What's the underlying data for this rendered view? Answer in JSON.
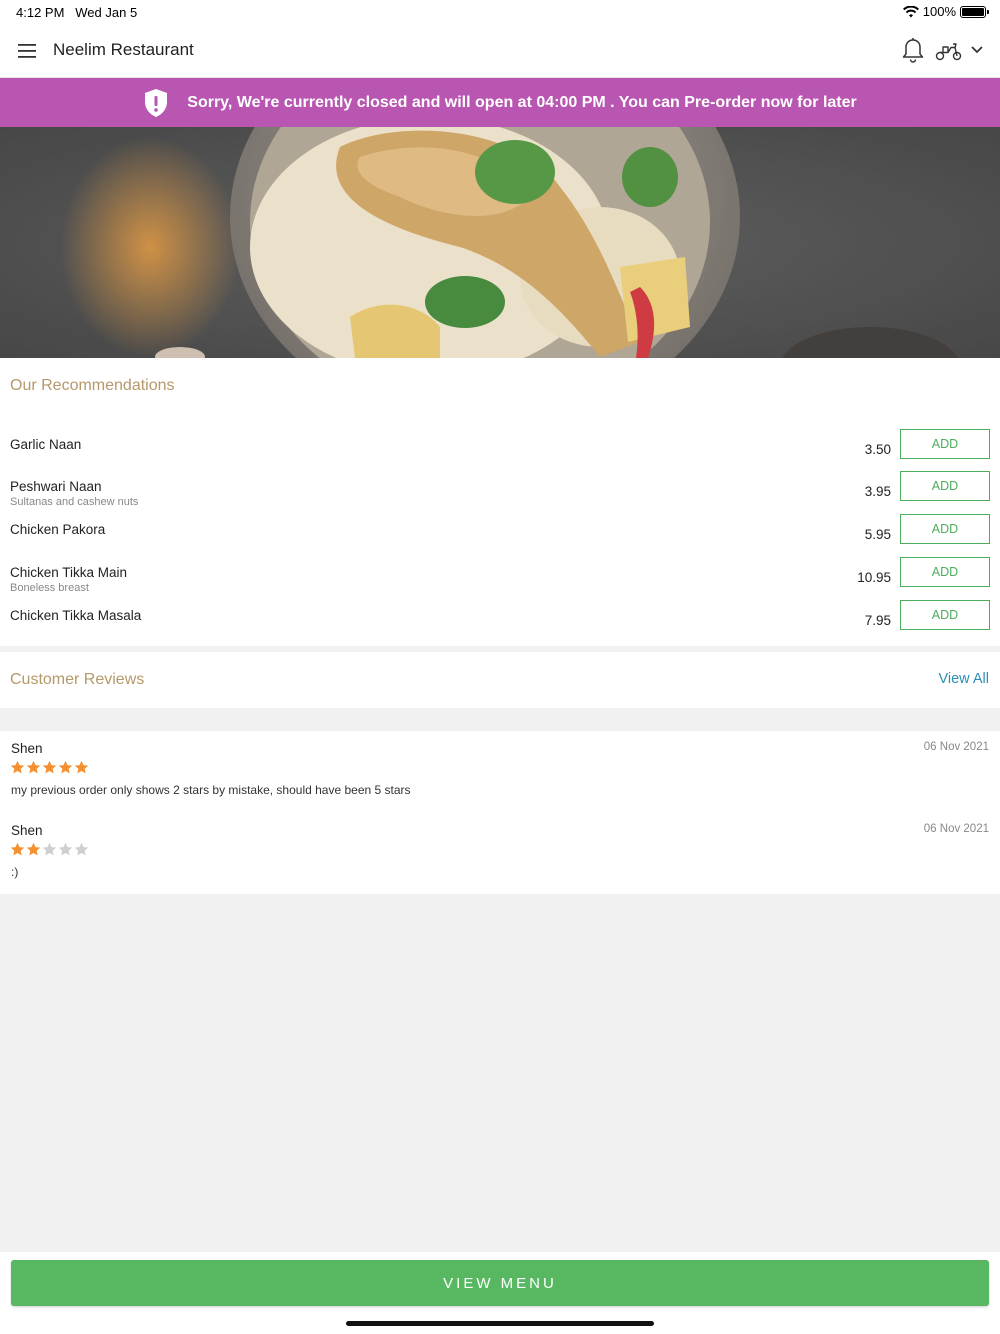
{
  "status_bar": {
    "time": "4:12 PM",
    "date": "Wed Jan 5",
    "battery": "100%",
    "battery_level": 1.0
  },
  "header": {
    "title": "Neelim Restaurant",
    "icons": [
      "menu-icon",
      "bell-icon",
      "scooter-icon",
      "chevron-down-icon"
    ]
  },
  "banner": {
    "message": "Sorry, We're currently closed and will open at 04:00 PM . You can Pre-order now for later",
    "icon": "shield-alert-icon",
    "color": "#b856b2"
  },
  "recommendations": {
    "title": "Our Recommendations",
    "add_label": "ADD",
    "items": [
      {
        "name": "Garlic Naan",
        "description": "",
        "price": "3.50"
      },
      {
        "name": "Peshwari Naan",
        "description": "Sultanas and cashew nuts",
        "price": "3.95"
      },
      {
        "name": "Chicken Pakora",
        "description": "",
        "price": "5.95"
      },
      {
        "name": "Chicken Tikka Main",
        "description": "Boneless breast",
        "price": "10.95"
      },
      {
        "name": "Chicken Tikka Masala",
        "description": "",
        "price": "7.95"
      }
    ]
  },
  "reviews": {
    "title": "Customer Reviews",
    "view_all": "View All",
    "items": [
      {
        "name": "Shen",
        "date": "06 Nov 2021",
        "rating": 5,
        "text": "my previous order only shows 2 stars by mistake, should have been 5 stars"
      },
      {
        "name": "Shen",
        "date": "06 Nov 2021",
        "rating": 2,
        "text": ":)"
      }
    ]
  },
  "footer": {
    "button_label": "VIEW MENU"
  },
  "colors": {
    "accent_green": "#58b862",
    "section_title": "#b5996a",
    "link_blue": "#2b8fb5",
    "star_filled": "#f39130",
    "star_empty": "#cfcfcf"
  }
}
